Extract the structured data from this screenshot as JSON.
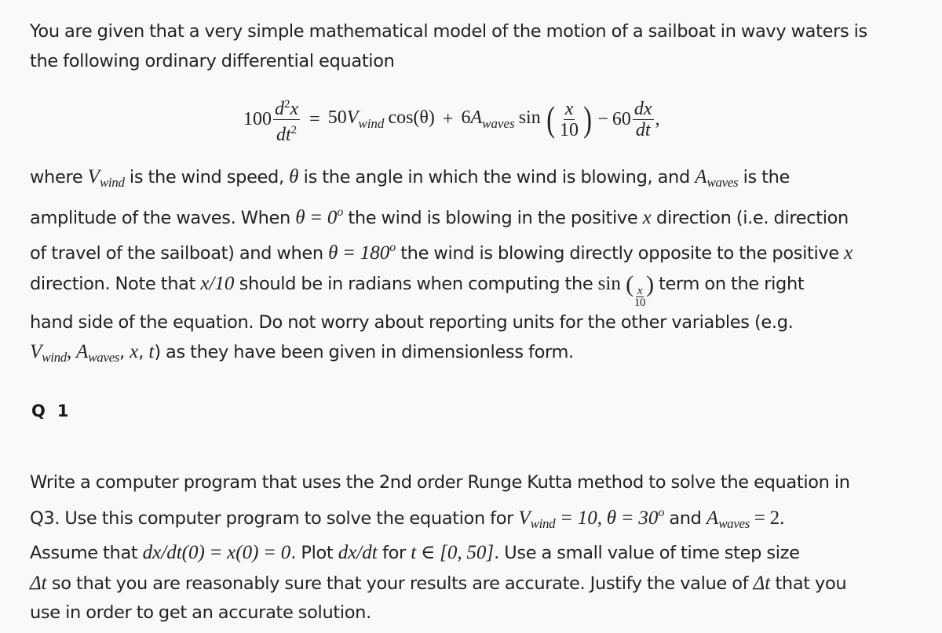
{
  "intro": {
    "line1": "You are given that a very simple mathematical model of the motion of a sailboat in wavy waters is",
    "line2": "the following ordinary differential equation"
  },
  "equation": {
    "lhs_coef": "100",
    "lhs_num": "d",
    "lhs_num_sup": "2",
    "lhs_num_var": "x",
    "lhs_den": "dt",
    "lhs_den_sup": "2",
    "eq": "=",
    "term1_coef": "50",
    "term1_var": "V",
    "term1_sub": "wind",
    "term1_fn": "cos(θ)",
    "plus": "+",
    "term2_coef": "6",
    "term2_var": "A",
    "term2_sub": "waves",
    "term2_fn": "sin",
    "term2_arg_num": "x",
    "term2_arg_den": "10",
    "minus": "−",
    "term3_coef": "60",
    "term3_num": "dx",
    "term3_den": "dt",
    "trailing": ","
  },
  "description": {
    "l1_a": "where ",
    "l1_v": "V",
    "l1_vsub": "wind",
    "l1_b": " is the wind speed, ",
    "l1_theta": "θ",
    "l1_c": " is the angle in which the wind is blowing, and ",
    "l1_a_var": "A",
    "l1_asub": "waves",
    "l1_d": " is the",
    "l2_a": "amplitude of the waves. When ",
    "l2_math": "θ = 0",
    "l2_sup": "o",
    "l2_b": " the wind is blowing in the positive ",
    "l2_x": "x",
    "l2_c": " direction (i.e. direction",
    "l3_a": "of travel of the sailboat) and when ",
    "l3_math": "θ = 180",
    "l3_sup": "o",
    "l3_b": " the wind is blowing directly opposite to the positive ",
    "l3_x": "x",
    "l4_a": "direction. Note that ",
    "l4_math": "x/10",
    "l4_b": " should be in radians when computing the ",
    "l4_sin": "sin",
    "l4_frac_num": "x",
    "l4_frac_den": "10",
    "l4_c": " term on the right",
    "l5": "hand side of the equation. Do not worry about reporting units for the other variables (e.g.",
    "l6_v": "V",
    "l6_vsub": "wind",
    "l6_comma1": ", ",
    "l6_a": "A",
    "l6_asub": "waves",
    "l6_comma2": ", ",
    "l6_x": "x",
    "l6_comma3": ", ",
    "l6_t": "t",
    "l6_rest": ") as they have been given in dimensionless form."
  },
  "question": {
    "label_q": "Q",
    "label_num": "1"
  },
  "task": {
    "l1": "Write a computer program that uses the 2nd order Runge Kutta method to solve the equation in",
    "l2_a": "Q3. Use this computer program to solve the equation for ",
    "l2_v": "V",
    "l2_vsub": "wind",
    "l2_math1": " = 10, θ = 30",
    "l2_sup": "o",
    "l2_b": " and ",
    "l2_a_var": "A",
    "l2_asub": "waves",
    "l2_math2": " = 2.",
    "l3_a": "Assume that ",
    "l3_math1": "dx/dt(0) = x(0) = 0",
    "l3_b": ". Plot ",
    "l3_math2": "dx/dt",
    "l3_c": " for ",
    "l3_math3": "t ∈ [0, 50]",
    "l3_d": ". Use a small value of time step size",
    "l4_delta": "Δt",
    "l4_a": " so that you are reasonably sure that your results are accurate. Justify the value of ",
    "l4_delta2": "Δt",
    "l4_b": " that you",
    "l5": "use in order to get an accurate solution."
  }
}
